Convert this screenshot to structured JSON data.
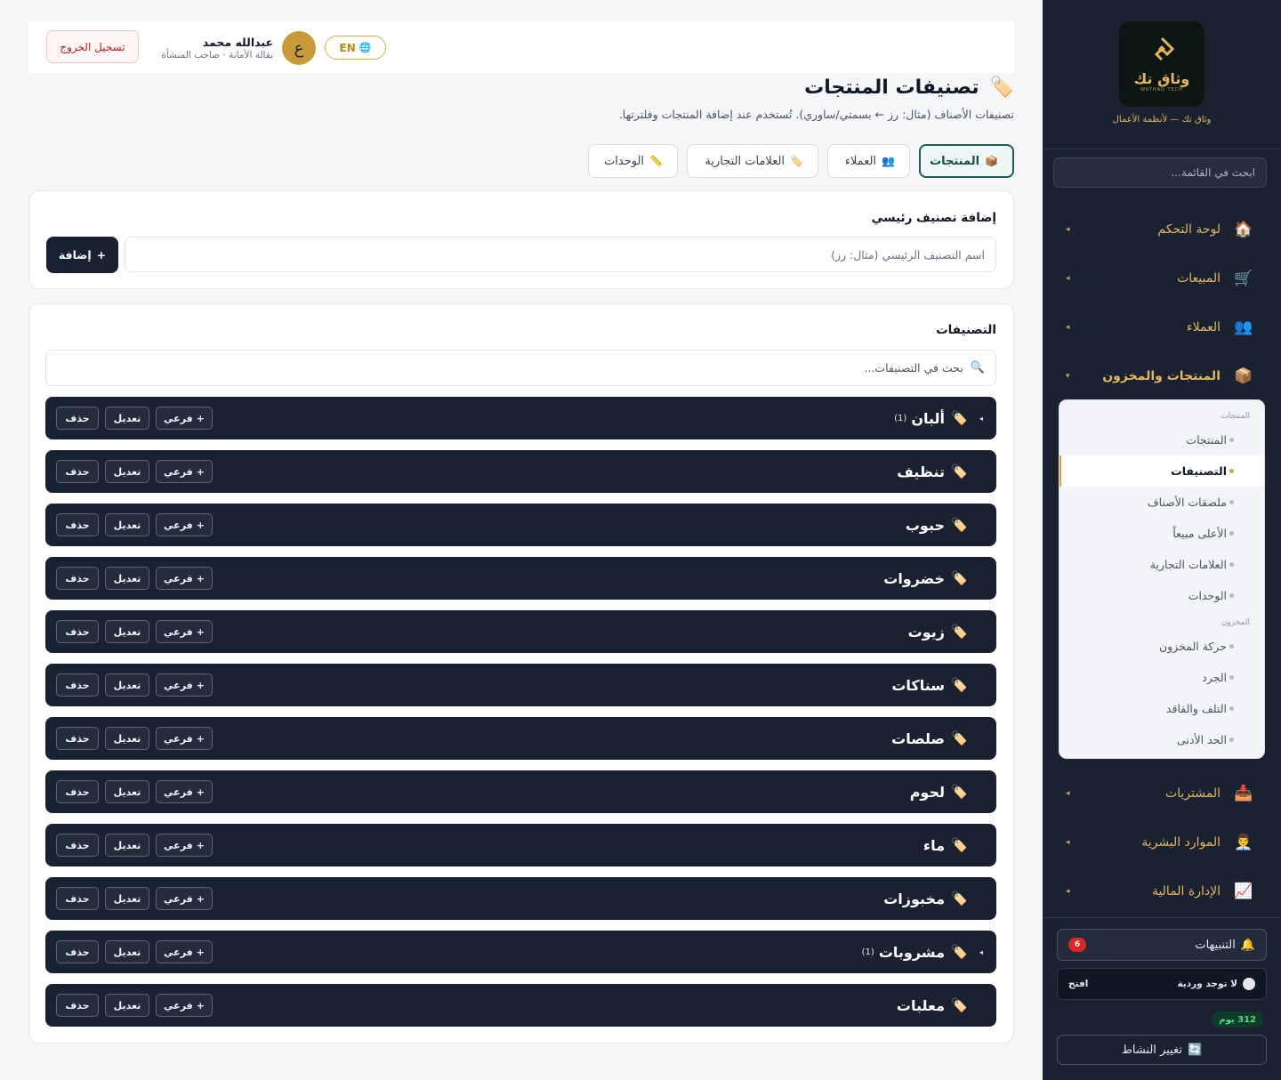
{
  "sidebar": {
    "brand_name": "وثاق تك",
    "brand_tiny": "WATHAQ TECH",
    "brand_tagline": "وثاق تك — لأنظمة الأعمال",
    "search_placeholder": "ابحث في القائمة...",
    "nav": [
      {
        "label": "لوحة التحكم",
        "icon": "🏠"
      },
      {
        "label": "المبيعات",
        "icon": "🛒"
      },
      {
        "label": "العملاء",
        "icon": "👥"
      },
      {
        "label": "المنتجات والمخزون",
        "icon": "📦"
      },
      {
        "label": "المشتريات",
        "icon": "📥"
      },
      {
        "label": "الموارد البشرية",
        "icon": "👨‍💼"
      },
      {
        "label": "الإدارة المالية",
        "icon": "📈"
      }
    ],
    "submenu": {
      "group_products": "المنتجات",
      "group_inventory": "المخزون",
      "items": [
        "المنتجات",
        "التصنيفات",
        "ملصقات الأصناف",
        "الأعلى مبيعاً",
        "العلامات التجارية",
        "الوحدات",
        "حركة المخزون",
        "الجرد",
        "التلف والفاقد",
        "الحد الأدنى"
      ]
    },
    "notifications_label": "التنبيهات",
    "notifications_count": "6",
    "shift_status": "لا توجد وردية",
    "shift_open": "افتح",
    "days_badge": "312 يوم",
    "switch_activity": "تغيير النشاط"
  },
  "topbar": {
    "lang": "EN",
    "avatar_letter": "ع",
    "user_name": "عبدالله محمد",
    "user_role": "بقالة الأمانة · صاحب المنشأة",
    "logout": "تسجيل الخروج"
  },
  "header": {
    "title": "تصنيفات المنتجات",
    "subtitle": "تصنيفات الأصناف (مثال: رز ← بسمتي/ساوري). تُستخدم عند إضافة المنتجات وفلترتها."
  },
  "tabs": [
    {
      "label": "المنتجات",
      "icon": "📦"
    },
    {
      "label": "العملاء",
      "icon": "👥"
    },
    {
      "label": "العلامات التجارية",
      "icon": "🏷️"
    },
    {
      "label": "الوحدات",
      "icon": "📏"
    }
  ],
  "add_section": {
    "title": "إضافة تصنيف رئيسي",
    "input_placeholder": "اسم التصنيف الرئيسي (مثال: رز)",
    "add_button": "إضافة"
  },
  "categories_section": {
    "title": "التصنيفات",
    "search_placeholder": "بحث في التصنيفات...",
    "btn_sub": "فرعي",
    "btn_edit": "تعديل",
    "btn_delete": "حذف",
    "items": [
      {
        "name": "ألبان",
        "count": "(1)",
        "expandable": true
      },
      {
        "name": "تنظيف",
        "count": "",
        "expandable": false
      },
      {
        "name": "حبوب",
        "count": "",
        "expandable": false
      },
      {
        "name": "خضروات",
        "count": "",
        "expandable": false
      },
      {
        "name": "زيوت",
        "count": "",
        "expandable": false
      },
      {
        "name": "سناكات",
        "count": "",
        "expandable": false
      },
      {
        "name": "صلصات",
        "count": "",
        "expandable": false
      },
      {
        "name": "لحوم",
        "count": "",
        "expandable": false
      },
      {
        "name": "ماء",
        "count": "",
        "expandable": false
      },
      {
        "name": "مخبوزات",
        "count": "",
        "expandable": false
      },
      {
        "name": "مشروبات",
        "count": "(1)",
        "expandable": true
      },
      {
        "name": "معلبات",
        "count": "",
        "expandable": false
      }
    ]
  }
}
